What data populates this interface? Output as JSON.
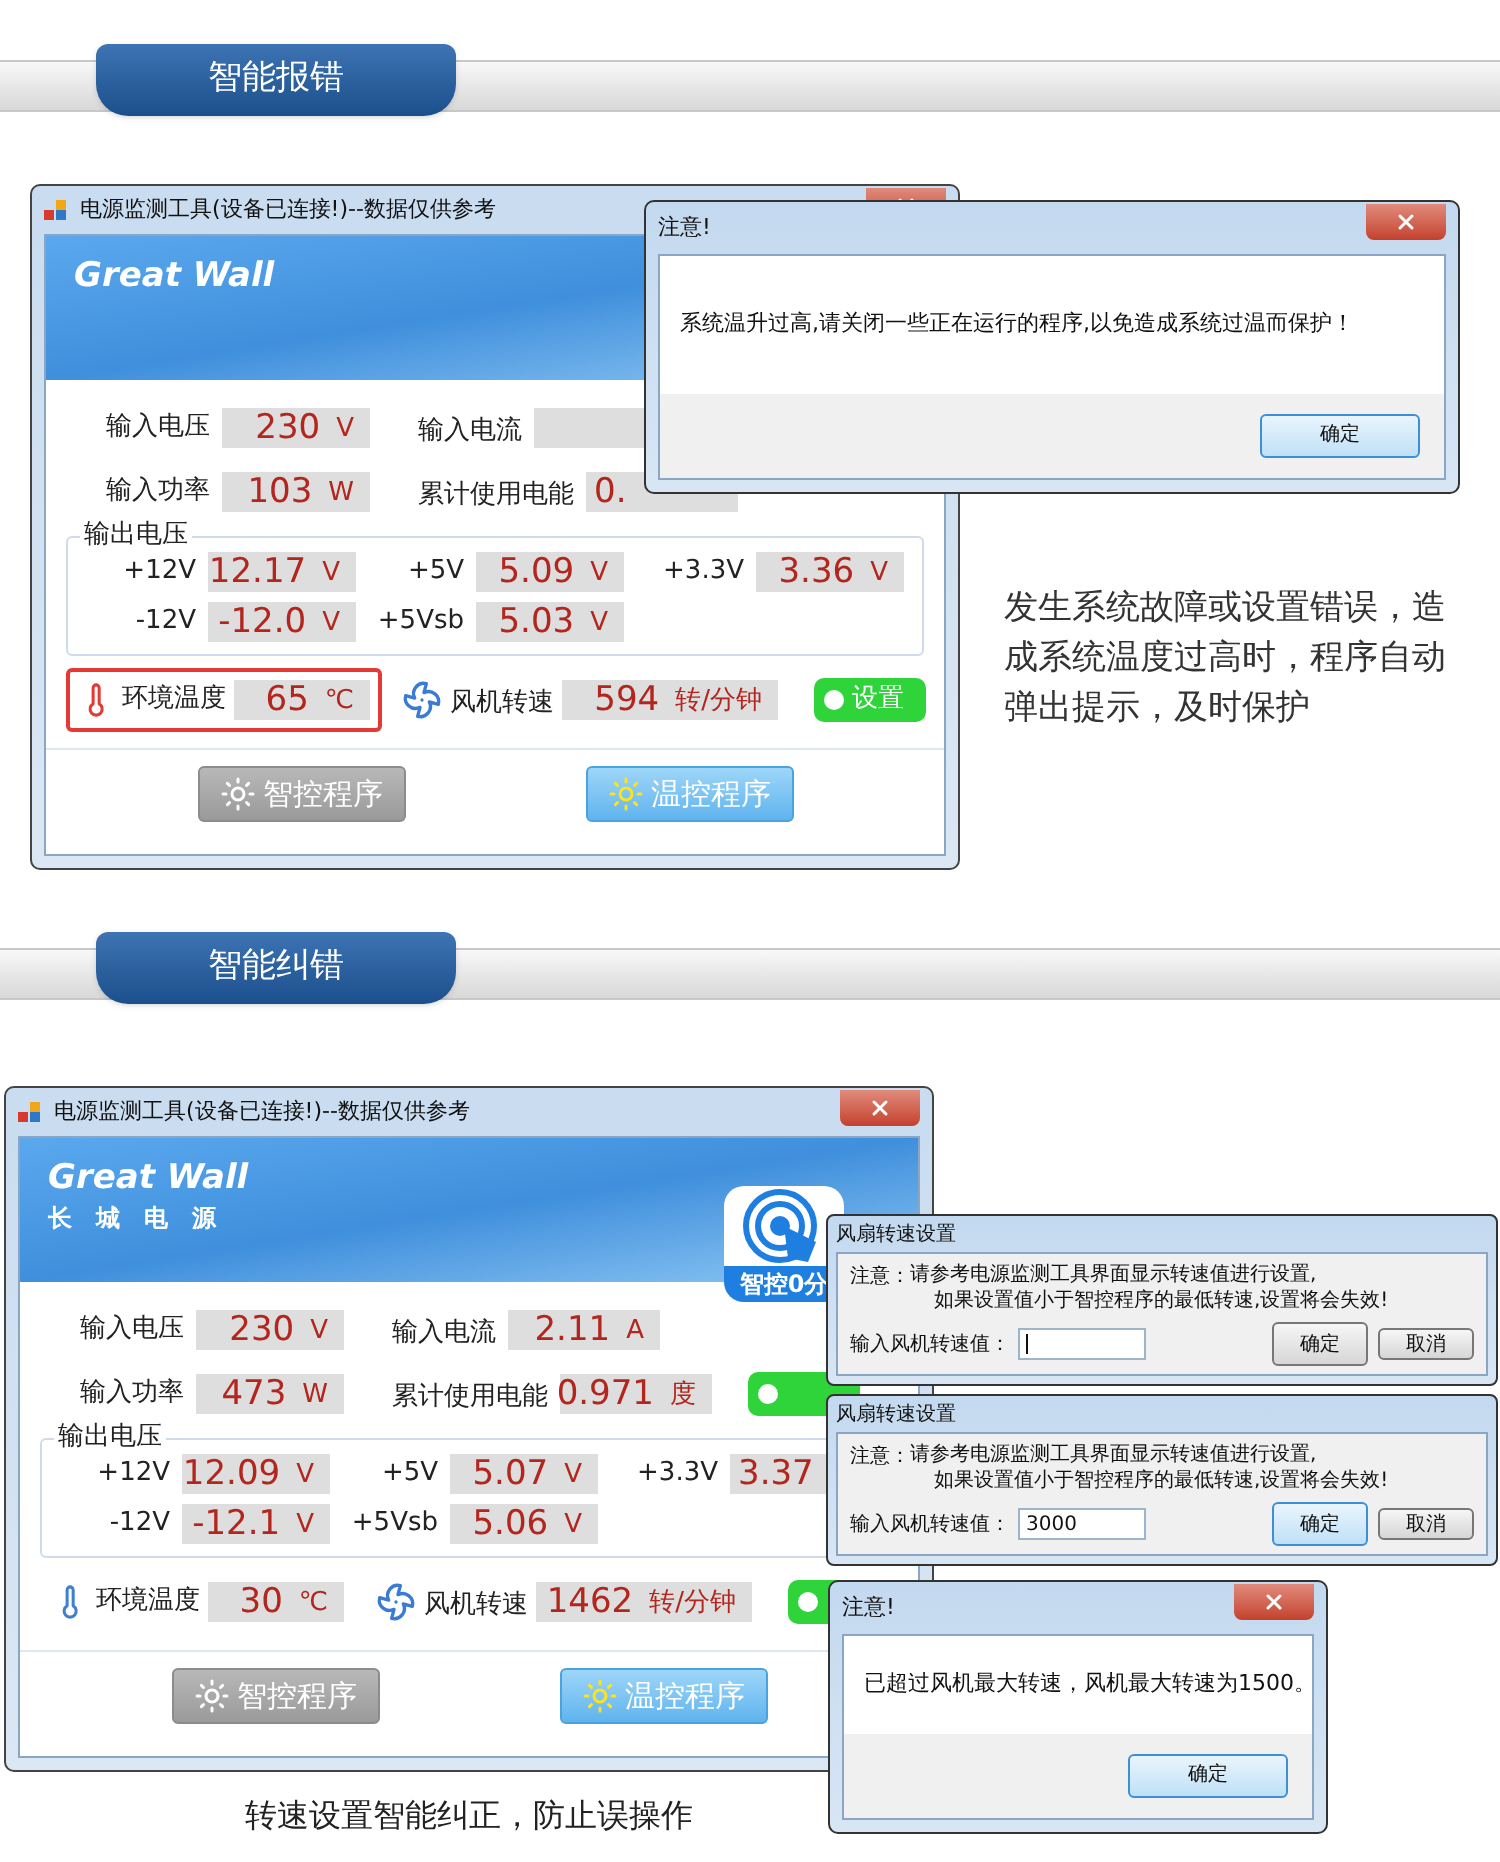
{
  "sections": [
    {
      "banner": "智能报错",
      "window": {
        "title": "电源监测工具(设备已连接!)--数据仅供参考",
        "brand": "Great Wall",
        "input_rows": [
          {
            "fields": [
              {
                "label": "输入电压",
                "value": "230",
                "unit": "V"
              },
              {
                "label": "输入电流"
              }
            ]
          },
          {
            "fields": [
              {
                "label": "输入功率",
                "value": "103",
                "unit": "W"
              },
              {
                "label": "累计使用电能",
                "value": "0."
              }
            ]
          }
        ],
        "output_group": "输出电压",
        "output_rows": [
          [
            {
              "label": "+12V",
              "value": "12.17",
              "unit": "V"
            },
            {
              "label": "+5V",
              "value": "5.09",
              "unit": "V"
            },
            {
              "label": "+3.3V",
              "value": "3.36",
              "unit": "V"
            }
          ],
          [
            {
              "label": "-12V",
              "value": "-12.0",
              "unit": "V"
            },
            {
              "label": "+5Vsb",
              "value": "5.03",
              "unit": "V"
            }
          ]
        ],
        "temperature": {
          "label": "环境温度",
          "value": "65",
          "unit": "℃",
          "alarm": true
        },
        "fan": {
          "label": "风机转速",
          "value": "594",
          "unit": "转/分钟",
          "button": {
            "label": "设置"
          }
        },
        "modes": [
          {
            "label": "智控程序",
            "selected": false
          },
          {
            "label": "温控程序",
            "selected": true
          }
        ]
      },
      "dialogs": [
        {
          "kind": "message",
          "title": "注意!",
          "text": "系统温升过高,请关闭一些正在运行的程序,以免造成系统过温而保护！",
          "ok": "确定",
          "ok_focused": true
        }
      ],
      "note": "发生系统故障或设置错误，造成系统温度过高时，程序自动弹出提示，及时保护"
    },
    {
      "banner": "智能纠错",
      "window": {
        "title": "电源监测工具(设备已连接!)--数据仅供参考",
        "brand": "Great Wall",
        "brand_sub": "长城电源",
        "badge": "智控0分",
        "input_rows": [
          {
            "fields": [
              {
                "label": "输入电压",
                "value": "230",
                "unit": "V"
              },
              {
                "label": "输入电流",
                "value": "2.11",
                "unit": "A"
              }
            ]
          },
          {
            "fields": [
              {
                "label": "输入功率",
                "value": "473",
                "unit": "W"
              },
              {
                "label": "累计使用电能",
                "value": "0.971",
                "unit": "度"
              }
            ],
            "button": true
          }
        ],
        "output_group": "输出电压",
        "output_rows": [
          [
            {
              "label": "+12V",
              "value": "12.09",
              "unit": "V"
            },
            {
              "label": "+5V",
              "value": "5.07",
              "unit": "V"
            },
            {
              "label": "+3.3V",
              "value": "3.37"
            }
          ],
          [
            {
              "label": "-12V",
              "value": "-12.1",
              "unit": "V"
            },
            {
              "label": "+5Vsb",
              "value": "5.06",
              "unit": "V"
            }
          ]
        ],
        "temperature": {
          "label": "环境温度",
          "value": "30",
          "unit": "℃",
          "alarm": false
        },
        "fan": {
          "label": "风机转速",
          "value": "1462",
          "unit": "转/分钟",
          "button": true
        },
        "modes": [
          {
            "label": "智控程序",
            "selected": false
          },
          {
            "label": "温控程序",
            "selected": true
          }
        ]
      },
      "dialogs": [
        {
          "kind": "input",
          "title": "风扇转速设置",
          "note_label": "注意：",
          "note_lines": [
            "请参考电源监测工具界面显示转速值进行设置,",
            "如果设置值小于智控程序的最低转速,设置将会失效!"
          ],
          "field_label": "输入风机转速值：",
          "ok": "确定",
          "cancel": "取消",
          "ok_focused": false
        },
        {
          "kind": "input",
          "title": "风扇转速设置",
          "note_label": "注意：",
          "note_lines": [
            "请参考电源监测工具界面显示转速值进行设置,",
            "如果设置值小于智控程序的最低转速,设置将会失效!"
          ],
          "field_label": "输入风机转速值：",
          "value": "3000",
          "ok": "确定",
          "cancel": "取消",
          "ok_focused": true
        },
        {
          "kind": "message",
          "title": "注意!",
          "text": "已超过风机最大转速，风机最大转速为1500。",
          "ok": "确定",
          "ok_focused": true
        }
      ],
      "caption": "转速设置智能纠正，防止误操作"
    }
  ]
}
